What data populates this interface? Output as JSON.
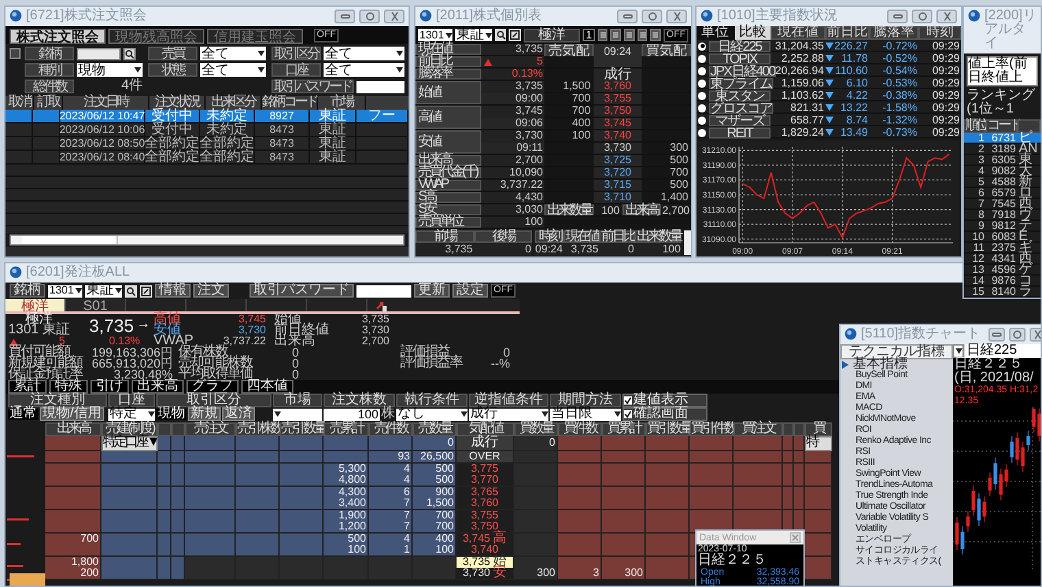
{
  "order_inquiry": {
    "title": "[6721]株式注文照会",
    "tabs": [
      {
        "label": "株式注文照会",
        "selected": true
      },
      {
        "label": "現物残高照会",
        "selected": false
      },
      {
        "label": "信用建玉照会",
        "selected": false
      }
    ],
    "toggle": {
      "label": "OFF",
      "on": false
    },
    "select_all_checked": false,
    "filters": [
      {
        "label": "銘柄",
        "kind": "search_input"
      },
      {
        "label": "売買",
        "value": "全て",
        "kind": "select"
      },
      {
        "label": "取引区分",
        "value": "全て",
        "kind": "select"
      },
      {
        "label": "種別",
        "value": "現物",
        "kind": "select"
      },
      {
        "label": "状態",
        "value": "全て",
        "kind": "select"
      },
      {
        "label": "口座",
        "value": "全て",
        "kind": "select"
      },
      {
        "label": "総件数",
        "value": "4件",
        "kind": "count"
      },
      {
        "label": "取引パスワード",
        "kind": "password"
      }
    ],
    "columns": [
      "取消",
      "訂取",
      "注文日時",
      "注文状況",
      "出来区分",
      "銘柄コード",
      "市場",
      null
    ],
    "rows": [
      {
        "cells": [
          null,
          null,
          "2023/06/12 10:47",
          "受付中",
          "未約定",
          "8927",
          "東証",
          "フー"
        ],
        "selected": true
      },
      {
        "cells": [
          null,
          null,
          "2023/06/12 10:06",
          "受付中",
          "未約定",
          "8473",
          "東証",
          null
        ],
        "selected": false
      },
      {
        "cells": [
          null,
          null,
          "2023/06/12 08:50",
          "全部約定",
          "全部約定",
          "8473",
          "東証",
          null
        ],
        "selected": false
      },
      {
        "cells": [
          null,
          null,
          "2023/06/12 08:40",
          "全部約定",
          "全部約定",
          "8473",
          "東証",
          null
        ],
        "selected": false
      }
    ]
  },
  "price_board": {
    "title": "[2011]株式個別表",
    "code": "1301",
    "market": "東証",
    "name": "極洋",
    "board_count": "1",
    "toggle": {
      "label": "OFF",
      "on": false
    },
    "stats": [
      {
        "label": "現在値",
        "value": "3,735",
        "kind": "plain"
      },
      {
        "label": "前日比",
        "value": "5",
        "kind": "up_arrow"
      },
      {
        "label": "騰落率",
        "value": "0.13%",
        "kind": "up"
      },
      {
        "label": "始値",
        "value": "3,735",
        "time": "09:00",
        "kind": "plain"
      },
      {
        "label": "高値",
        "value": "3,745",
        "time": "09:06",
        "kind": "plain"
      },
      {
        "label": "安値",
        "value": "3,730",
        "time": "09:11",
        "kind": "plain"
      },
      {
        "label": "出来高",
        "value": "2,700",
        "kind": "plain"
      },
      {
        "label": "売買代金(千)",
        "value": "10,090",
        "kind": "plain"
      },
      {
        "label": "VWAP",
        "value": "3,737.22",
        "kind": "plain"
      },
      {
        "label": "S高",
        "value": "4,430",
        "kind": "plain"
      },
      {
        "label": "S安",
        "value": "3,030",
        "kind": "plain"
      },
      {
        "label": "売買単位",
        "value": "100",
        "kind": "plain"
      }
    ],
    "columns": [
      "売気配",
      "09:24",
      "買気配"
    ],
    "quotes": [
      {
        "price": "成行",
        "kind": "market"
      },
      {
        "sell": "1,500",
        "price": "3,760",
        "kind": "ask"
      },
      {
        "sell": "700",
        "price": "3,755",
        "kind": "ask"
      },
      {
        "sell": "700",
        "price": "3,750",
        "kind": "ask"
      },
      {
        "sell": "400",
        "price": "3,745",
        "kind": "ask"
      },
      {
        "sell": "100",
        "price": "3,740",
        "kind": "ask"
      },
      {
        "price": "3,730",
        "buy": "300",
        "kind": "last"
      },
      {
        "price": "3,725",
        "buy": "500",
        "kind": "bid"
      },
      {
        "price": "3,720",
        "buy": "700",
        "kind": "bid"
      },
      {
        "price": "3,715",
        "buy": "500",
        "kind": "bid"
      },
      {
        "price": "3,710",
        "buy": "1,400",
        "kind": "bid"
      }
    ],
    "trade": [
      {
        "label": "出来数量",
        "value": "100"
      },
      {
        "label": "出来高",
        "value": "2,700"
      }
    ],
    "history_columns": [
      "前場",
      "後場",
      "時刻",
      "現在値",
      "前日比",
      "出来数量"
    ],
    "history_row": [
      "3,735",
      "0",
      "09:24",
      "3,735",
      "0",
      "100"
    ]
  },
  "index_status": {
    "title": "[1010]主要指数状況",
    "modes": [
      {
        "label": "単位",
        "selected": false
      },
      {
        "label": "比較",
        "selected": true
      }
    ],
    "columns": [
      "現在値",
      "前日比",
      "騰落率",
      "時刻"
    ],
    "rows": [
      {
        "name": "日経225",
        "value": "31,204.35",
        "kind": "down",
        "change": "226.27",
        "pct": "-0.72%",
        "time": "09:29",
        "selected": true
      },
      {
        "name": "TOPIX",
        "value": "2,252.88",
        "kind": "down",
        "change": "11.78",
        "pct": "-0.52%",
        "time": "09:29",
        "selected": false
      },
      {
        "name": "JPX日経400",
        "value": "20,266.94",
        "kind": "down",
        "change": "110.60",
        "pct": "-0.54%",
        "time": "09:29",
        "selected": false
      },
      {
        "name": "東プライム",
        "value": "1,159.06",
        "kind": "down",
        "change": "6.10",
        "pct": "-0.53%",
        "time": "09:29",
        "selected": false
      },
      {
        "name": "東スタン",
        "value": "1,103.62",
        "kind": "down",
        "change": "4.22",
        "pct": "-0.38%",
        "time": "09:29",
        "selected": false
      },
      {
        "name": "グロスコア",
        "value": "821.31",
        "kind": "down",
        "change": "13.22",
        "pct": "-1.58%",
        "time": "09:29",
        "selected": false
      },
      {
        "name": "マザーズ",
        "value": "658.77",
        "kind": "down",
        "change": "8.74",
        "pct": "-1.32%",
        "time": "09:29",
        "selected": false
      },
      {
        "name": "REIT",
        "value": "1,829.24",
        "kind": "down",
        "change": "13.49",
        "pct": "-0.73%",
        "time": "09:29",
        "selected": false
      }
    ],
    "chart_data": {
      "type": "line",
      "grid": true,
      "ylim": [
        31085,
        31215
      ],
      "categories": [
        "09:00",
        null,
        null,
        null,
        null,
        null,
        null,
        "09:07",
        null,
        null,
        null,
        null,
        null,
        null,
        "09:14",
        null,
        null,
        null,
        null,
        null,
        null,
        "09:21",
        null,
        null,
        null,
        null,
        null,
        null,
        null,
        null
      ],
      "series": [
        {
          "color": "#e02020",
          "values": [
            31165,
            31160,
            31150,
            31145,
            31180,
            31140,
            31125,
            31118,
            31125,
            31135,
            31140,
            31125,
            31105,
            31110,
            31092,
            31118,
            31125,
            31128,
            31132,
            31138,
            31140,
            31145,
            31170,
            31200,
            31190,
            31160,
            31195,
            31200,
            31198,
            31205
          ]
        }
      ],
      "yticks": [
        {
          "value": 31210,
          "label": "31210.00"
        },
        {
          "value": 31190,
          "label": "31190.00"
        },
        {
          "value": 31170,
          "label": "31170.00"
        },
        {
          "value": 31150,
          "label": "31150.00"
        },
        {
          "value": 31130,
          "label": "31130.00"
        },
        {
          "value": 31110,
          "label": "31110.00"
        },
        {
          "value": 31090,
          "label": "31090.00"
        }
      ]
    }
  },
  "ranking": {
    "title": "[2200]リアルタイ",
    "ranking_type": "値上率(前日終値上",
    "caption": "ランキング(1位～1",
    "columns": [
      "順位",
      "コード"
    ],
    "rows": [
      {
        "rank": "1",
        "code": "6731",
        "name": "ピ",
        "selected": true
      },
      {
        "rank": "2",
        "code": "3189",
        "name": "AN",
        "selected": false
      },
      {
        "rank": "3",
        "code": "6305",
        "name": "東",
        "selected": false
      },
      {
        "rank": "4",
        "code": "9082",
        "name": "大",
        "selected": false
      },
      {
        "rank": "5",
        "code": "4588",
        "name": "新",
        "selected": false
      },
      {
        "rank": "6",
        "code": "6579",
        "name": "ロ",
        "selected": false
      },
      {
        "rank": "7",
        "code": "7545",
        "name": "西",
        "selected": false
      },
      {
        "rank": "8",
        "code": "7918",
        "name": "ヴ",
        "selected": false
      },
      {
        "rank": "9",
        "code": "9812",
        "name": "テ",
        "selected": false
      },
      {
        "rank": "10",
        "code": "6083",
        "name": "E",
        "selected": false
      },
      {
        "rank": "11",
        "code": "2375",
        "name": "ギ",
        "selected": false
      },
      {
        "rank": "12",
        "code": "4341",
        "name": "西",
        "selected": false
      },
      {
        "rank": "13",
        "code": "4596",
        "name": "ゲ",
        "selected": false
      },
      {
        "rank": "14",
        "code": "9876",
        "name": "コ",
        "selected": false
      },
      {
        "rank": "15",
        "code": "8140",
        "name": "ラ",
        "selected": false
      }
    ]
  },
  "order_board": {
    "title": "[6201]発注板ALL",
    "toolbar": {
      "code_label": "銘柄",
      "code": "1301",
      "market": "東証",
      "buttons": [
        "情報",
        "注文"
      ],
      "password_label": "取引パスワード",
      "actions": [
        "更新",
        "設定"
      ],
      "toggle": {
        "label": "OFF",
        "on": false
      }
    },
    "tabs": [
      {
        "label": "極洋",
        "selected": true
      },
      {
        "label": "S01",
        "selected": false
      }
    ],
    "quote": {
      "name": "極洋",
      "code_market": "1301 東証",
      "price": "3,735",
      "arrow": "→",
      "change": "5",
      "change_pct": "0.13%",
      "stats": [
        {
          "label": "高値",
          "value": "3,745",
          "kind": "high"
        },
        {
          "label": "始値",
          "value": "3,735",
          "kind": "plain"
        },
        {
          "label": "安値",
          "value": "3,730",
          "kind": "low"
        },
        {
          "label": "前日終値",
          "value": "3,730",
          "kind": "plain"
        },
        {
          "label": "VWAP",
          "value": "3,737.22",
          "kind": "plain"
        },
        {
          "label": "出来高",
          "value": "2,700",
          "kind": "plain"
        }
      ]
    },
    "account": [
      [
        {
          "label": "買付可能額",
          "value": "199,163,306円"
        },
        {
          "label": "保有株数",
          "value": "0"
        },
        {
          "label": "評価損益",
          "value": "0"
        }
      ],
      [
        {
          "label": "新規建可能額",
          "value": "665,913,020円"
        },
        {
          "label": "売却可能株数",
          "value": "0"
        },
        {
          "label": "評価損益率",
          "value": "--%"
        }
      ],
      [
        {
          "label": "保証金預託率",
          "value": "3,230.48%"
        },
        {
          "label": "平均取得単価",
          "value": "0"
        }
      ]
    ],
    "sub_tabs": [
      "累計",
      "特殊",
      "引け",
      "出来高",
      "グラフ",
      "四本値"
    ],
    "form_headers": [
      "注文種別",
      "口座",
      "取引区分",
      "市場",
      "注文株数",
      "執行条件",
      "逆指値条件",
      "期間方法"
    ],
    "form_controls": [
      [
        {
          "kind": "label",
          "text": "通常"
        },
        {
          "kind": "button",
          "text": "現物/信用"
        }
      ],
      [
        {
          "kind": "select",
          "text": "特定"
        }
      ],
      [
        {
          "kind": "label",
          "text": "現物"
        },
        {
          "kind": "button",
          "text": "新規"
        },
        {
          "kind": "button",
          "text": "返済"
        }
      ],
      [
        {
          "kind": "select"
        }
      ],
      [
        {
          "kind": "qty",
          "text": "100",
          "unit": "株"
        }
      ],
      [
        {
          "kind": "select",
          "text": "なし"
        }
      ],
      [
        {
          "kind": "select",
          "text": "成行"
        }
      ],
      [
        {
          "kind": "select",
          "text": "当日限"
        }
      ]
    ],
    "form_checks": [
      {
        "label": "建値表示",
        "checked": true
      },
      {
        "label": "確認画面",
        "checked": true
      }
    ],
    "columns": [
      "出来高",
      "売建(制度)",
      null,
      null,
      "売注文",
      "売引株数",
      "売引数量",
      "売累計",
      "売件数",
      "売数量",
      "気配値",
      "買数量",
      "買件数",
      "買累計",
      "買引数量",
      "買引件数",
      "買注文",
      null,
      null,
      "買"
    ],
    "row_controls": [
      "特定口座▼",
      "特"
    ],
    "rows": [
      {
        "kind": "market",
        "sell_qty": "0",
        "price": "成行",
        "buy_qty": "0"
      },
      {
        "kind": "over",
        "sell_count": "93",
        "sell_qty": "26,500",
        "price": "OVER"
      },
      {
        "kind": "ask",
        "sell_cum": "5,300",
        "sell_count": "4",
        "sell_qty": "500",
        "price": "3,775"
      },
      {
        "kind": "ask",
        "sell_cum": "4,800",
        "sell_count": "4",
        "sell_qty": "500",
        "price": "3,770"
      },
      {
        "kind": "ask",
        "sell_cum": "4,300",
        "sell_count": "6",
        "sell_qty": "900",
        "price": "3,765"
      },
      {
        "kind": "ask",
        "sell_cum": "3,400",
        "sell_count": "7",
        "sell_qty": "1,500",
        "price": "3,760"
      },
      {
        "kind": "ask",
        "sell_cum": "1,900",
        "sell_count": "7",
        "sell_qty": "700",
        "price": "3,755"
      },
      {
        "kind": "ask",
        "sell_cum": "1,200",
        "sell_count": "7",
        "sell_qty": "700",
        "price": "3,750"
      },
      {
        "kind": "ask",
        "volume": "700",
        "sell_cum": "500",
        "sell_count": "4",
        "sell_qty": "400",
        "price": "3,745",
        "mark": "高"
      },
      {
        "kind": "ask",
        "sell_cum": "100",
        "sell_count": "1",
        "sell_qty": "100",
        "price": "3,740"
      },
      {
        "kind": "current",
        "volume": "1,800",
        "price": "3,735",
        "mark": "始"
      },
      {
        "kind": "bid",
        "volume": "200",
        "price": "3,730",
        "mark": "安",
        "buy_qty": "300",
        "buy_count": "3",
        "buy_cum": "300"
      }
    ]
  },
  "index_chart": {
    "title": "[5110]指数チャート",
    "panel_title": "テクニカル指標",
    "symbol": "日経225",
    "chart_title": "日経２２５(日, 2021/08/",
    "ohlc": "O:31,204.35 H:31,212.35",
    "indicators": [
      {
        "label": "基本指標",
        "kind": "group"
      },
      {
        "label": "BuySell Point",
        "kind": "item"
      },
      {
        "label": "DMI",
        "kind": "item"
      },
      {
        "label": "EMA",
        "kind": "item"
      },
      {
        "label": "MACD",
        "kind": "item"
      },
      {
        "label": "NickMNotMove",
        "kind": "item"
      },
      {
        "label": "ROI",
        "kind": "item"
      },
      {
        "label": "Renko Adaptive Inc",
        "kind": "item"
      },
      {
        "label": "RSI",
        "kind": "item"
      },
      {
        "label": "RSIII",
        "kind": "item"
      },
      {
        "label": "SwingPoint View",
        "kind": "item"
      },
      {
        "label": "TrendLines-Automa",
        "kind": "item"
      },
      {
        "label": "True Strength Inde",
        "kind": "item"
      },
      {
        "label": "Ultimate Oscillator",
        "kind": "item"
      },
      {
        "label": "Variable Volatility S",
        "kind": "item"
      },
      {
        "label": "Volatility",
        "kind": "item"
      },
      {
        "label": "エンベロープ",
        "kind": "item"
      },
      {
        "label": "サイコロジカルライ",
        "kind": "item"
      },
      {
        "label": "ストキャスティクス(",
        "kind": "item"
      }
    ]
  },
  "data_window": {
    "title": "Data Window",
    "date": "2023-07-10",
    "symbol": "日経２２５",
    "values": [
      {
        "label": "Open",
        "value": "32,393.46"
      },
      {
        "label": "High",
        "value": "32,558.90"
      }
    ]
  }
}
